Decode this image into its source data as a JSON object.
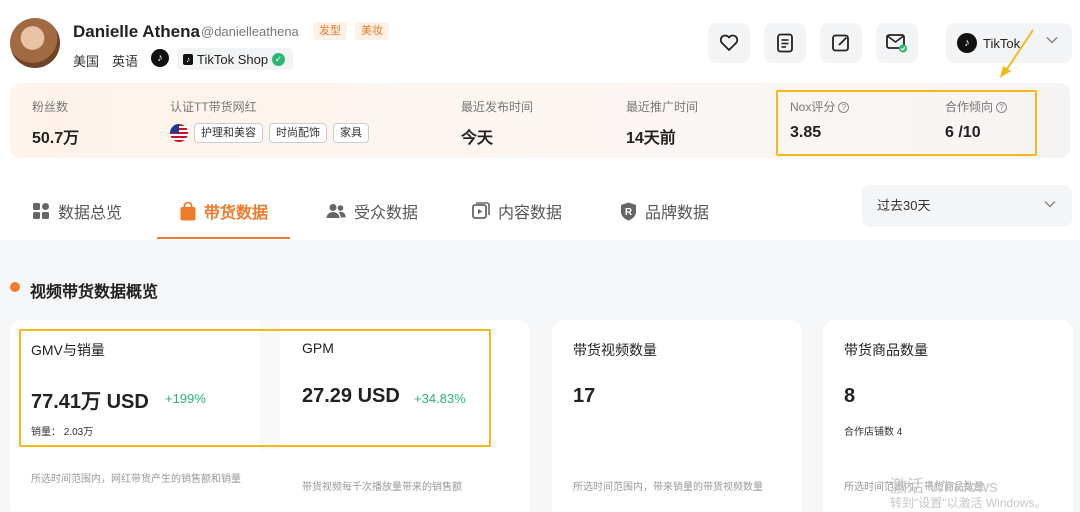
{
  "profile": {
    "name": "Danielle Athena",
    "handle": "@danielleathena",
    "tags": [
      "发型",
      "美妆"
    ],
    "country": "美国",
    "language": "英语",
    "shop_label": "TikTok Shop",
    "icons": [
      "tiktok-icon",
      "shop-bag-icon",
      "verified-icon"
    ]
  },
  "header_actions": {
    "buttons": [
      "heart-icon",
      "document-icon",
      "edit-icon",
      "mail-icon"
    ],
    "platform": "TikTok"
  },
  "stats": {
    "followers_label": "粉丝数",
    "followers_value": "50.7万",
    "certified_label": "认证TT带货网红",
    "categories": [
      "护理和美容",
      "时尚配饰",
      "家具"
    ],
    "last_post_label": "最近发布时间",
    "last_post_value": "今天",
    "last_promo_label": "最近推广时间",
    "last_promo_value": "14天前",
    "nox_label": "Nox评分",
    "nox_value": "3.85",
    "coop_label": "合作倾向",
    "coop_value": "6 /10"
  },
  "tabs": [
    {
      "label": "数据总览",
      "icon": "grid-icon"
    },
    {
      "label": "带货数据",
      "icon": "shopping-bag-icon"
    },
    {
      "label": "受众数据",
      "icon": "users-icon"
    },
    {
      "label": "内容数据",
      "icon": "video-icon"
    },
    {
      "label": "品牌数据",
      "icon": "brand-icon"
    }
  ],
  "active_tab": "带货数据",
  "range": "过去30天",
  "section": {
    "title": "视频带货数据概览"
  },
  "cards": {
    "gmv": {
      "title": "GMV与销量",
      "value": "77.41万 USD",
      "change": "+199%",
      "sub": "销量： 2.03万",
      "desc": "所选时间范围内，网红带货产生的销售额和销量"
    },
    "gpm": {
      "title": "GPM",
      "value": "27.29 USD",
      "change": "+34.83%",
      "desc": "带货视频每千次播放量带来的销售额"
    },
    "videos": {
      "title": "带货视频数量",
      "value": "17",
      "desc": "所选时间范围内，带来销量的带货视频数量"
    },
    "products": {
      "title": "带货商品数量",
      "value": "8",
      "sub": "合作店铺数 4",
      "desc": "所选时间范围内，带货商品数量"
    }
  },
  "watermark": {
    "line1": "激活 Windows",
    "line2": "转到\"设置\"以激活 Windows。"
  },
  "colors": {
    "accent": "#f07b2b",
    "highlight": "#f5b81b",
    "positive": "#2bb673"
  }
}
